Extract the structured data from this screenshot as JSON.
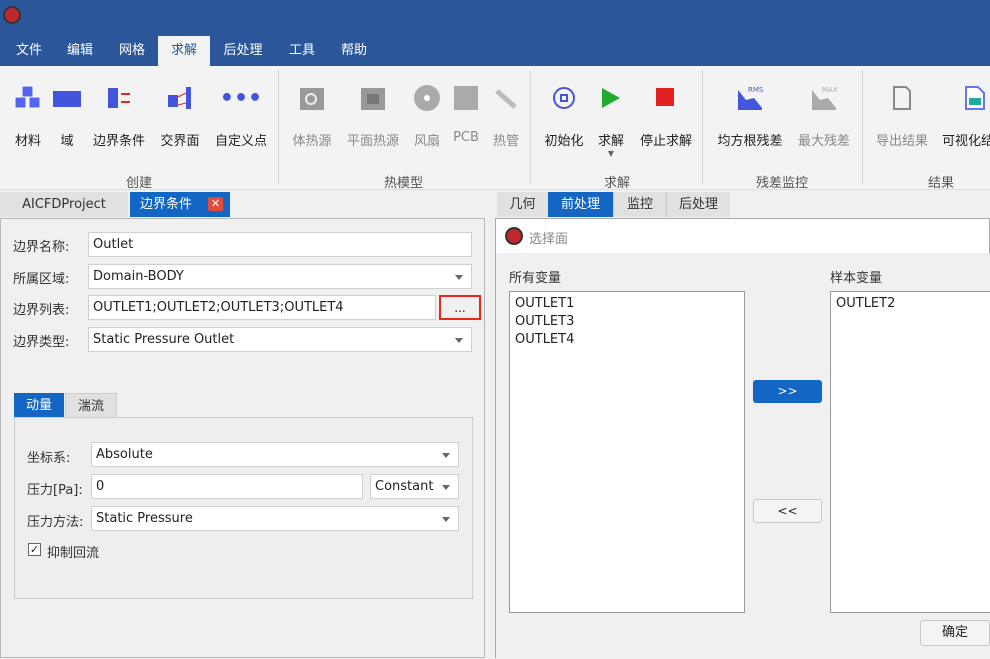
{
  "menu": [
    "文件",
    "编辑",
    "网格",
    "求解",
    "后处理",
    "工具",
    "帮助"
  ],
  "active_menu": "求解",
  "ribbon": {
    "create": {
      "label": "创建",
      "items": [
        "材料",
        "域",
        "边界条件",
        "交界面",
        "自定义点"
      ]
    },
    "thermal": {
      "label": "热模型",
      "items": [
        "体热源",
        "平面热源",
        "风扇",
        "PCB",
        "热管"
      ]
    },
    "solve": {
      "label": "求解",
      "items": [
        "初始化",
        "求解",
        "停止求解"
      ]
    },
    "residual": {
      "label": "残差监控",
      "items": [
        "均方根残差",
        "最大残差"
      ],
      "icon_text": [
        "RMS",
        "MAX"
      ]
    },
    "results": {
      "label": "结果",
      "items": [
        "导出结果",
        "可视化结果"
      ]
    }
  },
  "left_tabs": [
    "AICFDProject",
    "边界条件"
  ],
  "form": {
    "name_label": "边界名称:",
    "name_value": "Outlet",
    "domain_label": "所属区域:",
    "domain_value": "Domain-BODY",
    "list_label": "边界列表:",
    "list_value": "OUTLET1;OUTLET2;OUTLET3;OUTLET4",
    "browse": "...",
    "type_label": "边界类型:",
    "type_value": "Static Pressure Outlet"
  },
  "sub_tabs": [
    "动量",
    "湍流"
  ],
  "momentum": {
    "coord_label": "坐标系:",
    "coord_value": "Absolute",
    "pressure_label": "压力[Pa]:",
    "pressure_value": "0",
    "pressure_mode": "Constant",
    "method_label": "压力方法:",
    "method_value": "Static Pressure",
    "backflow_label": "抑制回流",
    "backflow_checked": true
  },
  "right_tabs": [
    "几何",
    "前处理",
    "监控",
    "后处理"
  ],
  "dialog": {
    "title": "选择面",
    "all_label": "所有变量",
    "all_items": [
      "OUTLET1",
      "OUTLET3",
      "OUTLET4"
    ],
    "sample_label": "样本变量",
    "sample_items": [
      "OUTLET2"
    ],
    "add": ">>",
    "remove": "<<",
    "ok": "确定"
  },
  "colors": {
    "brand": "#2b579a",
    "tab_active": "#1366c4",
    "highlight": "#e8281e"
  }
}
